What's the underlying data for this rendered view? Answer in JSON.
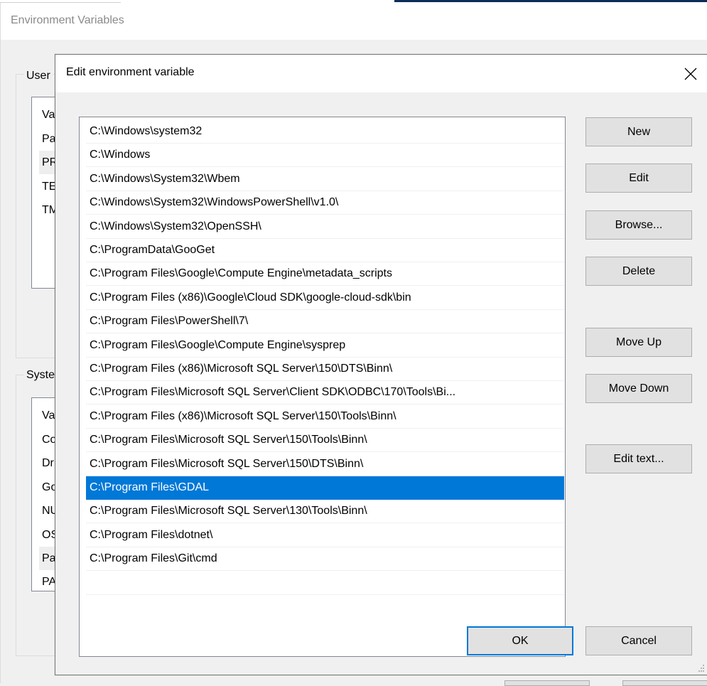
{
  "background_window": {
    "title": "Environment Variables",
    "user_group_label": "User",
    "user_list": {
      "header": "Va",
      "rows": [
        "Pa",
        "PR",
        "TE",
        "TM"
      ],
      "highlighted_index": 1
    },
    "system_group_label": "Syste",
    "system_list": {
      "header": "Va",
      "rows": [
        "Co",
        "Dr",
        "Go",
        "NU",
        "OS",
        "Pa",
        "PA"
      ],
      "highlighted_index": 5
    }
  },
  "dialog": {
    "title": "Edit environment variable",
    "close_icon": "close-icon",
    "paths": [
      "C:\\Windows\\system32",
      "C:\\Windows",
      "C:\\Windows\\System32\\Wbem",
      "C:\\Windows\\System32\\WindowsPowerShell\\v1.0\\",
      "C:\\Windows\\System32\\OpenSSH\\",
      "C:\\ProgramData\\GooGet",
      "C:\\Program Files\\Google\\Compute Engine\\metadata_scripts",
      "C:\\Program Files (x86)\\Google\\Cloud SDK\\google-cloud-sdk\\bin",
      "C:\\Program Files\\PowerShell\\7\\",
      "C:\\Program Files\\Google\\Compute Engine\\sysprep",
      "C:\\Program Files (x86)\\Microsoft SQL Server\\150\\DTS\\Binn\\",
      "C:\\Program Files\\Microsoft SQL Server\\Client SDK\\ODBC\\170\\Tools\\Bi...",
      "C:\\Program Files (x86)\\Microsoft SQL Server\\150\\Tools\\Binn\\",
      "C:\\Program Files\\Microsoft SQL Server\\150\\Tools\\Binn\\",
      "C:\\Program Files\\Microsoft SQL Server\\150\\DTS\\Binn\\",
      "C:\\Program Files\\GDAL",
      "C:\\Program Files\\Microsoft SQL Server\\130\\Tools\\Binn\\",
      "C:\\Program Files\\dotnet\\",
      "C:\\Program Files\\Git\\cmd",
      ""
    ],
    "selected_index": 15,
    "buttons": {
      "new": "New",
      "edit": "Edit",
      "browse": "Browse...",
      "delete": "Delete",
      "move_up": "Move Up",
      "move_down": "Move Down",
      "edit_text": "Edit text..."
    },
    "footer": {
      "ok": "OK",
      "cancel": "Cancel"
    }
  },
  "colors": {
    "selection": "#0078d7",
    "focus_border": "#0078d7",
    "button_face": "#e1e1e1",
    "window_bg": "#f0f0f0"
  }
}
